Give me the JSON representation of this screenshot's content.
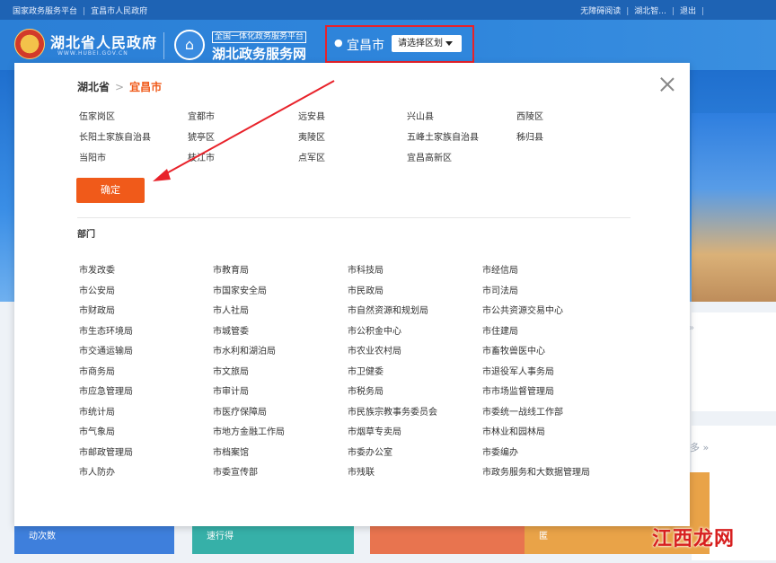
{
  "topbar": {
    "left": [
      "国家政务服务平台",
      "宜昌市人民政府"
    ],
    "right": [
      "无障碍阅读",
      "湖北智...",
      "退出"
    ]
  },
  "header": {
    "gov_title": "湖北省人民政府",
    "gov_sub": "WWW.HUBEI.GOV.CN",
    "svc_tag": "全国一体化政务服务平台",
    "svc_title": "湖北政务服务网",
    "city": "宜昌市",
    "region_select": "请选择区划"
  },
  "modal": {
    "crumb_province": "湖北省",
    "crumb_sep": ">",
    "crumb_city": "宜昌市",
    "districts": [
      [
        "伍家岗区",
        "宜都市",
        "远安县",
        "兴山县",
        "西陵区"
      ],
      [
        "长阳土家族自治县",
        "猇亭区",
        "夷陵区",
        "五峰土家族自治县",
        "秭归县"
      ],
      [
        "当阳市",
        "枝江市",
        "点军区",
        "宜昌高新区"
      ]
    ],
    "confirm": "确定",
    "dept_heading": "部门",
    "departments": [
      [
        "市发改委",
        "市教育局",
        "市科技局",
        "市经信局"
      ],
      [
        "市公安局",
        "市国家安全局",
        "市民政局",
        "市司法局"
      ],
      [
        "市财政局",
        "市人社局",
        "市自然资源和规划局",
        "市公共资源交易中心"
      ],
      [
        "市生态环境局",
        "市城管委",
        "市公积金中心",
        "市住建局"
      ],
      [
        "市交通运输局",
        "市水利和湖泊局",
        "市农业农村局",
        "市畜牧兽医中心"
      ],
      [
        "市商务局",
        "市文旅局",
        "市卫健委",
        "市退役军人事务局"
      ],
      [
        "市应急管理局",
        "市审计局",
        "市税务局",
        "市市场监督管理局"
      ],
      [
        "市统计局",
        "市医疗保障局",
        "市民族宗教事务委员会",
        "市委统一战线工作部"
      ],
      [
        "市气象局",
        "市地方金融工作局",
        "市烟草专卖局",
        "市林业和园林局"
      ],
      [
        "市邮政管理局",
        "市档案馆",
        "市委办公室",
        "市委编办"
      ],
      [
        "市人防办",
        "市委宣传部",
        "市残联",
        "市政务服务和大数据管理局"
      ]
    ]
  },
  "background": {
    "more": "多 »",
    "card1": "动次数",
    "card2": "速行得",
    "card4": "匿"
  },
  "watermark": "江西龙网",
  "colors": {
    "accent": "#f05a1a",
    "highlight": "#e8222a",
    "header": "#2b7fd6"
  }
}
